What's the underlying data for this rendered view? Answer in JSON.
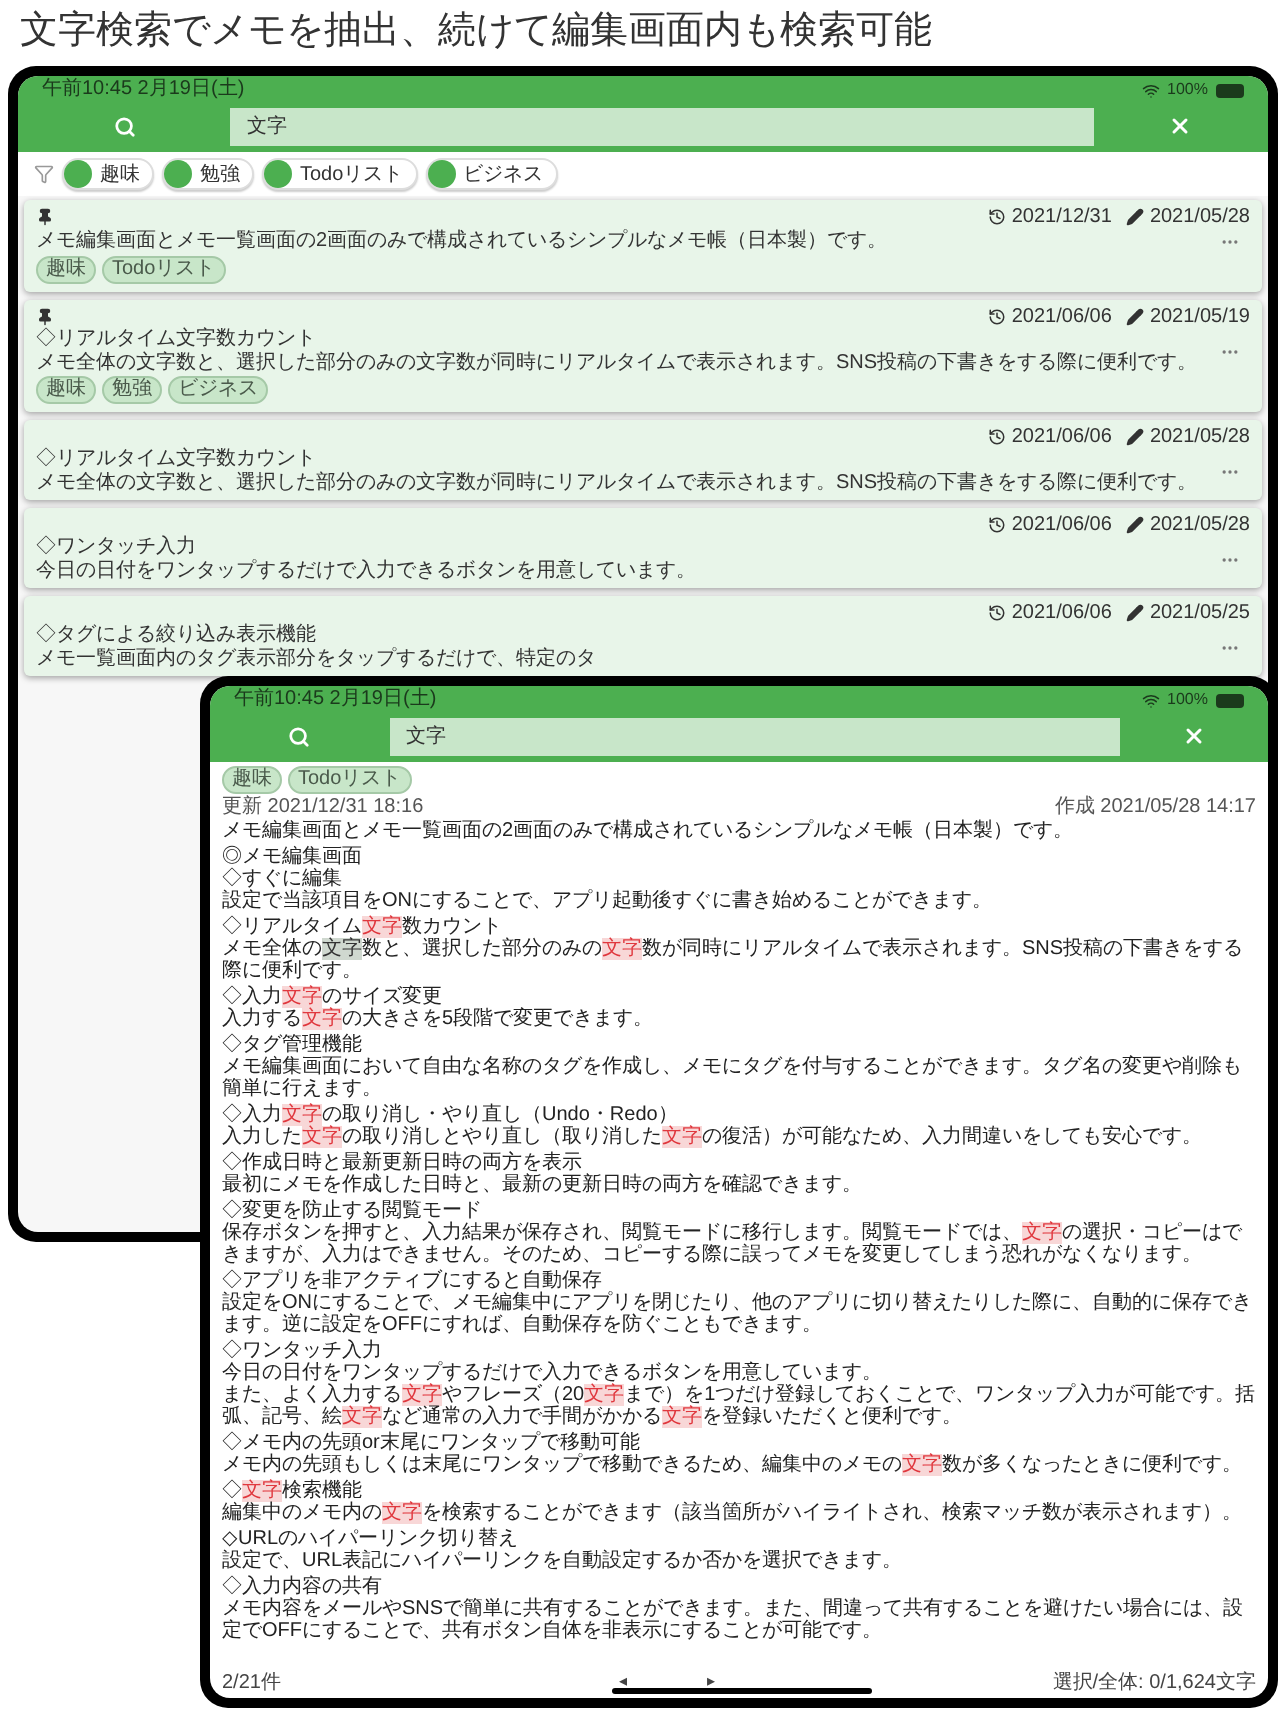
{
  "headline": "文字検索でメモを抽出、続けて編集画面内も検索可能",
  "list_screen": {
    "status_bar": {
      "time": "午前10:45 2月19日(土)",
      "battery": "100%"
    },
    "search": {
      "value": "文字"
    },
    "filter_tags": [
      "趣味",
      "勉強",
      "Todoリスト",
      "ビジネス"
    ],
    "cards": [
      {
        "pinned": true,
        "updated": "2021/12/31",
        "created": "2021/05/28",
        "lines": [
          "メモ編集画面とメモ一覧画面の2画面のみで構成されているシンプルなメモ帳（日本製）です。"
        ],
        "tags": [
          "趣味",
          "Todoリスト"
        ]
      },
      {
        "pinned": true,
        "updated": "2021/06/06",
        "created": "2021/05/19",
        "lines": [
          "◇リアルタイム文字数カウント",
          "メモ全体の文字数と、選択した部分のみの文字数が同時にリアルタイムで表示されます。SNS投稿の下書きをする際に便利です。"
        ],
        "tags": [
          "趣味",
          "勉強",
          "ビジネス"
        ]
      },
      {
        "pinned": false,
        "updated": "2021/06/06",
        "created": "2021/05/28",
        "lines": [
          "◇リアルタイム文字数カウント",
          "メモ全体の文字数と、選択した部分のみの文字数が同時にリアルタイムで表示されます。SNS投稿の下書きをする際に便利です。"
        ]
      },
      {
        "pinned": false,
        "updated": "2021/06/06",
        "created": "2021/05/28",
        "lines": [
          "◇ワンタッチ入力",
          "今日の日付をワンタップするだけで入力できるボタンを用意しています。"
        ]
      },
      {
        "pinned": false,
        "updated": "2021/06/06",
        "created": "2021/05/25",
        "lines": [
          "◇タグによる絞り込み表示機能",
          "メモ一覧画面内のタグ表示部分をタップするだけで、特定のタ"
        ]
      }
    ]
  },
  "edit_screen": {
    "status_bar": {
      "time": "午前10:45 2月19日(土)",
      "battery": "100%"
    },
    "search": {
      "value": "文字"
    },
    "tags": [
      "趣味",
      "Todoリスト"
    ],
    "updated": "更新 2021/12/31 18:16",
    "created": "作成 2021/05/28 14:17",
    "blocks": [
      [
        [
          "メモ編集画面とメモ一覧画面の2画面のみで構成されているシンプルなメモ帳（日本製）です。"
        ]
      ],
      [
        [
          "◎メモ編集画面"
        ],
        [
          "◇すぐに編集"
        ],
        [
          "設定で当該項目をONにすることで、アプリ起動後すぐに書き始めることができます。"
        ]
      ],
      [
        [
          "◇リアルタイム",
          {
            "text": "文字",
            "kind": "match"
          },
          "数カウント"
        ],
        [
          "メモ全体の",
          {
            "text": "文字",
            "kind": "current"
          },
          "数と、選択した部分のみの",
          {
            "text": "文字",
            "kind": "match"
          },
          "数が同時にリアルタイムで表示されます。SNS投稿の下書きをする際に便利です。"
        ]
      ],
      [
        [
          "◇入力",
          {
            "text": "文字",
            "kind": "match"
          },
          "のサイズ変更"
        ],
        [
          "入力する",
          {
            "text": "文字",
            "kind": "match"
          },
          "の大きさを5段階で変更できます。"
        ]
      ],
      [
        [
          "◇タグ管理機能"
        ],
        [
          "メモ編集画面において自由な名称のタグを作成し、メモにタグを付与することができます。タグ名の変更や削除も簡単に行えます。"
        ]
      ],
      [
        [
          "◇入力",
          {
            "text": "文字",
            "kind": "match"
          },
          "の取り消し・やり直し（Undo・Redo）"
        ],
        [
          "入力した",
          {
            "text": "文字",
            "kind": "match"
          },
          "の取り消しとやり直し（取り消した",
          {
            "text": "文字",
            "kind": "match"
          },
          "の復活）が可能なため、入力間違いをしても安心です。"
        ]
      ],
      [
        [
          "◇作成日時と最新更新日時の両方を表示"
        ],
        [
          "最初にメモを作成した日時と、最新の更新日時の両方を確認できます。"
        ]
      ],
      [
        [
          "◇変更を防止する閲覧モード"
        ],
        [
          "保存ボタンを押すと、入力結果が保存され、閲覧モードに移行します。閲覧モードでは、",
          {
            "text": "文字",
            "kind": "match"
          },
          "の選択・コピーはできますが、入力はできません。そのため、コピーする際に誤ってメモを変更してしまう恐れがなくなります。"
        ]
      ],
      [
        [
          "◇アプリを非アクティブにすると自動保存"
        ],
        [
          "設定をONにすることで、メモ編集中にアプリを閉じたり、他のアプリに切り替えたりした際に、自動的に保存できます。逆に設定をOFFにすれば、自動保存を防ぐこともできます。"
        ]
      ],
      [
        [
          "◇ワンタッチ入力"
        ],
        [
          "今日の日付をワンタップするだけで入力できるボタンを用意しています。"
        ],
        [
          "また、よく入力する",
          {
            "text": "文字",
            "kind": "match"
          },
          "やフレーズ（20",
          {
            "text": "文字",
            "kind": "match"
          },
          "まで）を1つだけ登録しておくことで、ワンタップ入力が可能です。括弧、記号、絵",
          {
            "text": "文字",
            "kind": "match"
          },
          "など通常の入力で手間がかかる",
          {
            "text": "文字",
            "kind": "match"
          },
          "を登録いただくと便利です。"
        ]
      ],
      [
        [
          "◇メモ内の先頭or末尾にワンタップで移動可能"
        ],
        [
          "メモ内の先頭もしくは末尾にワンタップで移動できるため、編集中のメモの",
          {
            "text": "文字",
            "kind": "match"
          },
          "数が多くなったときに便利です。"
        ]
      ],
      [
        [
          "◇",
          {
            "text": "文字",
            "kind": "match"
          },
          "検索機能"
        ],
        [
          "編集中のメモ内の",
          {
            "text": "文字",
            "kind": "match"
          },
          "を検索することができます（該当箇所がハイライトされ、検索マッチ数が表示されます）。"
        ]
      ],
      [
        [
          "◇URLのハイパーリンク切り替え"
        ],
        [
          "設定で、URL表記にハイパーリンクを自動設定するか否かを選択できます。"
        ]
      ],
      [
        [
          "◇入力内容の共有"
        ],
        [
          "メモ内容をメールやSNSで簡単に共有することができます。また、間違って共有することを避けたい場合には、設定でOFFにすることで、共有ボタン自体を非表示にすることが可能です。"
        ]
      ]
    ],
    "footer": {
      "count": "2/21件",
      "prev": "◂",
      "next": "▸",
      "chars": "選択/全体: 0/1,624文字"
    }
  }
}
